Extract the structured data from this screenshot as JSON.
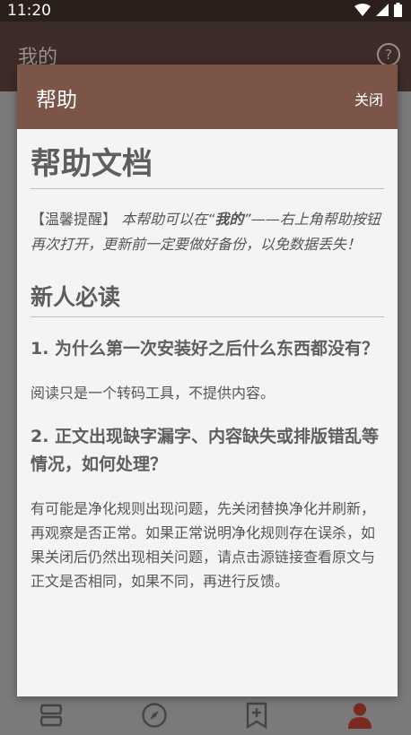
{
  "status_bar": {
    "time": "11:20"
  },
  "app_bar": {
    "title": "我的"
  },
  "dialog": {
    "title": "帮助",
    "close_label": "关闭",
    "doc_title": "帮助文档",
    "tip_label": "【温馨提醒】",
    "tip_text_before": " 本帮助可以在“",
    "tip_text_bold": "我的",
    "tip_text_after": "”——右上角帮助按钮再次打开，更新前一定要做好备份，以免数据丢失！",
    "section_title": "新人必读",
    "faq": [
      {
        "question": "1. 为什么第一次安装好之后什么东西都没有？",
        "answer": "阅读只是一个转码工具，不提供内容。"
      },
      {
        "question": "2. 正文出现缺字漏字、内容缺失或排版错乱等情况，如何处理？",
        "answer": "有可能是净化规则出现问题，先关闭替换净化并刷新，再观察是否正常。如果正常说明净化规则存在误杀，如果关闭后仍然出现相关问题，请点击源链接查看原文与正文是否相同，如果不同，再进行反馈。"
      }
    ]
  },
  "bottom_nav": {
    "items": [
      {
        "icon": "bookshelf-icon"
      },
      {
        "icon": "compass-icon"
      },
      {
        "icon": "bookmark-icon"
      },
      {
        "icon": "person-icon",
        "active": true
      }
    ],
    "active_color": "#7a2a20",
    "inactive_color": "#4a4a4a"
  },
  "colors": {
    "dialog_header": "#7a5548",
    "status_bar": "#2b1f1b"
  }
}
